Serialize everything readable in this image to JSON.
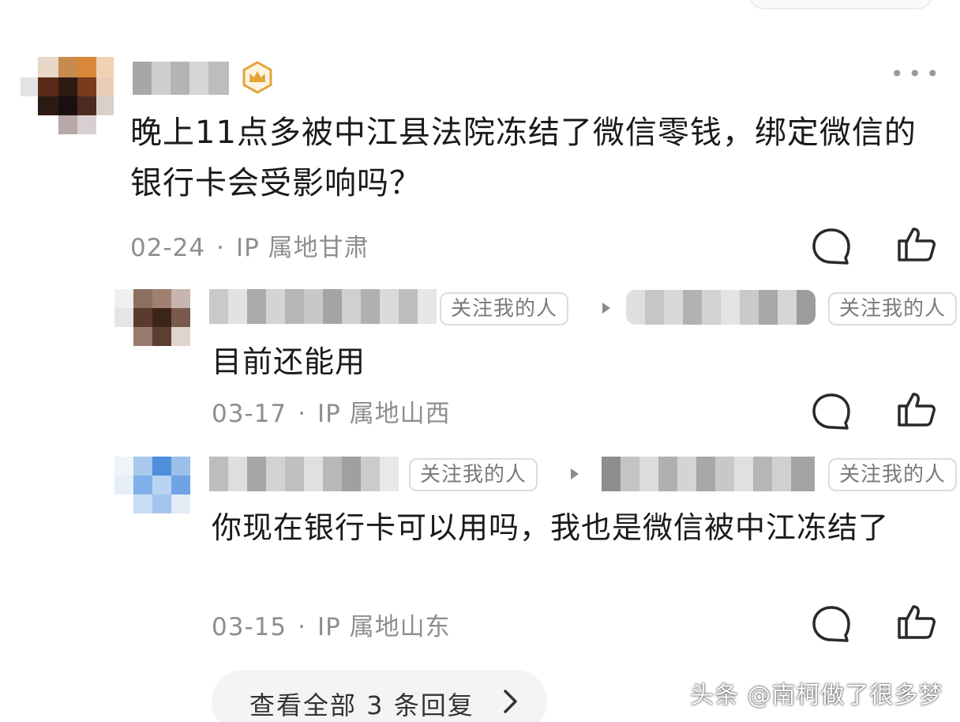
{
  "main_comment": {
    "text": "晚上11点多被中江县法院冻结了微信零钱，绑定微信的银行卡会受影响吗？",
    "date": "02-24",
    "ip_location": "IP 属地甘肃",
    "icons": [
      "crown-badge-icon",
      "more-icon",
      "comment-icon",
      "like-icon"
    ]
  },
  "replies": [
    {
      "follow_tag": "关注我的人",
      "target_tag": "关注我的人",
      "text": "目前还能用",
      "date": "03-17",
      "ip_location": "IP 属地山西"
    },
    {
      "follow_tag": "关注我的人",
      "target_tag": "关注我的人",
      "text": "你现在银行卡可以用吗，我也是微信被中江冻结了",
      "date": "03-15",
      "ip_location": "IP 属地山东"
    }
  ],
  "view_all_replies": "查看全部 3 条回复",
  "watermark": "头条 @南柯做了很多梦",
  "colors": {
    "crown_badge": "#e3a43a",
    "meta_text": "#8e8e8e",
    "tag_border": "#dcdcdc"
  }
}
